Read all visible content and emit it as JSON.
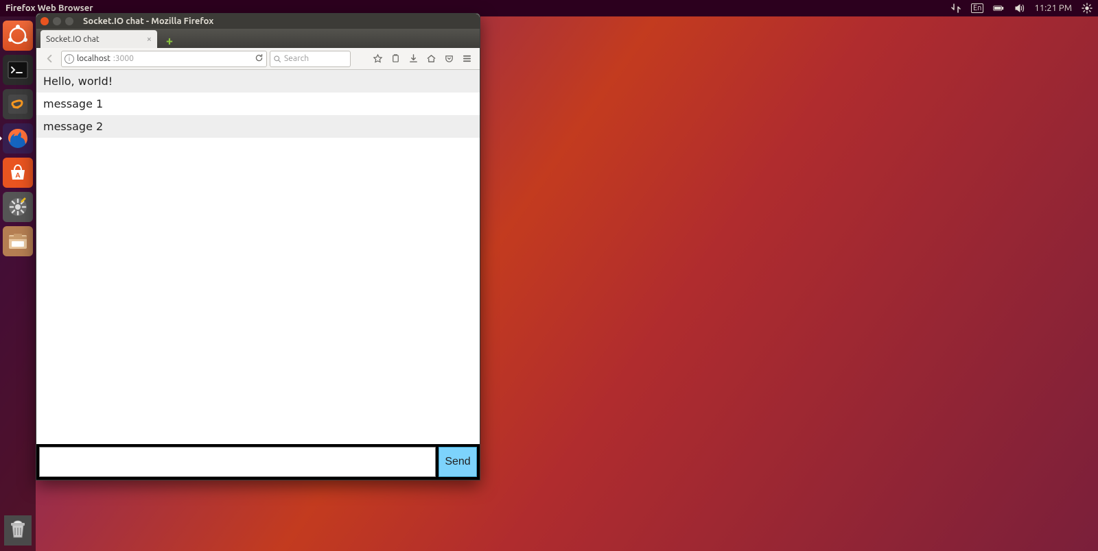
{
  "menubar": {
    "app_title": "Firefox Web Browser",
    "lang_indicator": "En",
    "clock": "11:21 PM"
  },
  "launcher": {
    "items": [
      {
        "name": "ubuntu-dash",
        "kind": "dash"
      },
      {
        "name": "terminal",
        "kind": "terminal"
      },
      {
        "name": "sublime-text",
        "kind": "sublime"
      },
      {
        "name": "firefox",
        "kind": "firefox",
        "active": true
      },
      {
        "name": "ubuntu-software",
        "kind": "software"
      },
      {
        "name": "system-settings",
        "kind": "settings"
      },
      {
        "name": "files",
        "kind": "files"
      }
    ],
    "trash": {
      "name": "trash"
    }
  },
  "window": {
    "title": "Socket.IO chat - Mozilla Firefox",
    "tab": {
      "label": "Socket.IO chat"
    },
    "url": {
      "host": "localhost",
      "port": ":3000"
    },
    "search_placeholder": "Search"
  },
  "chat": {
    "messages": [
      "Hello, world!",
      "message 1",
      "message 2"
    ],
    "input_value": "",
    "send_label": "Send"
  }
}
